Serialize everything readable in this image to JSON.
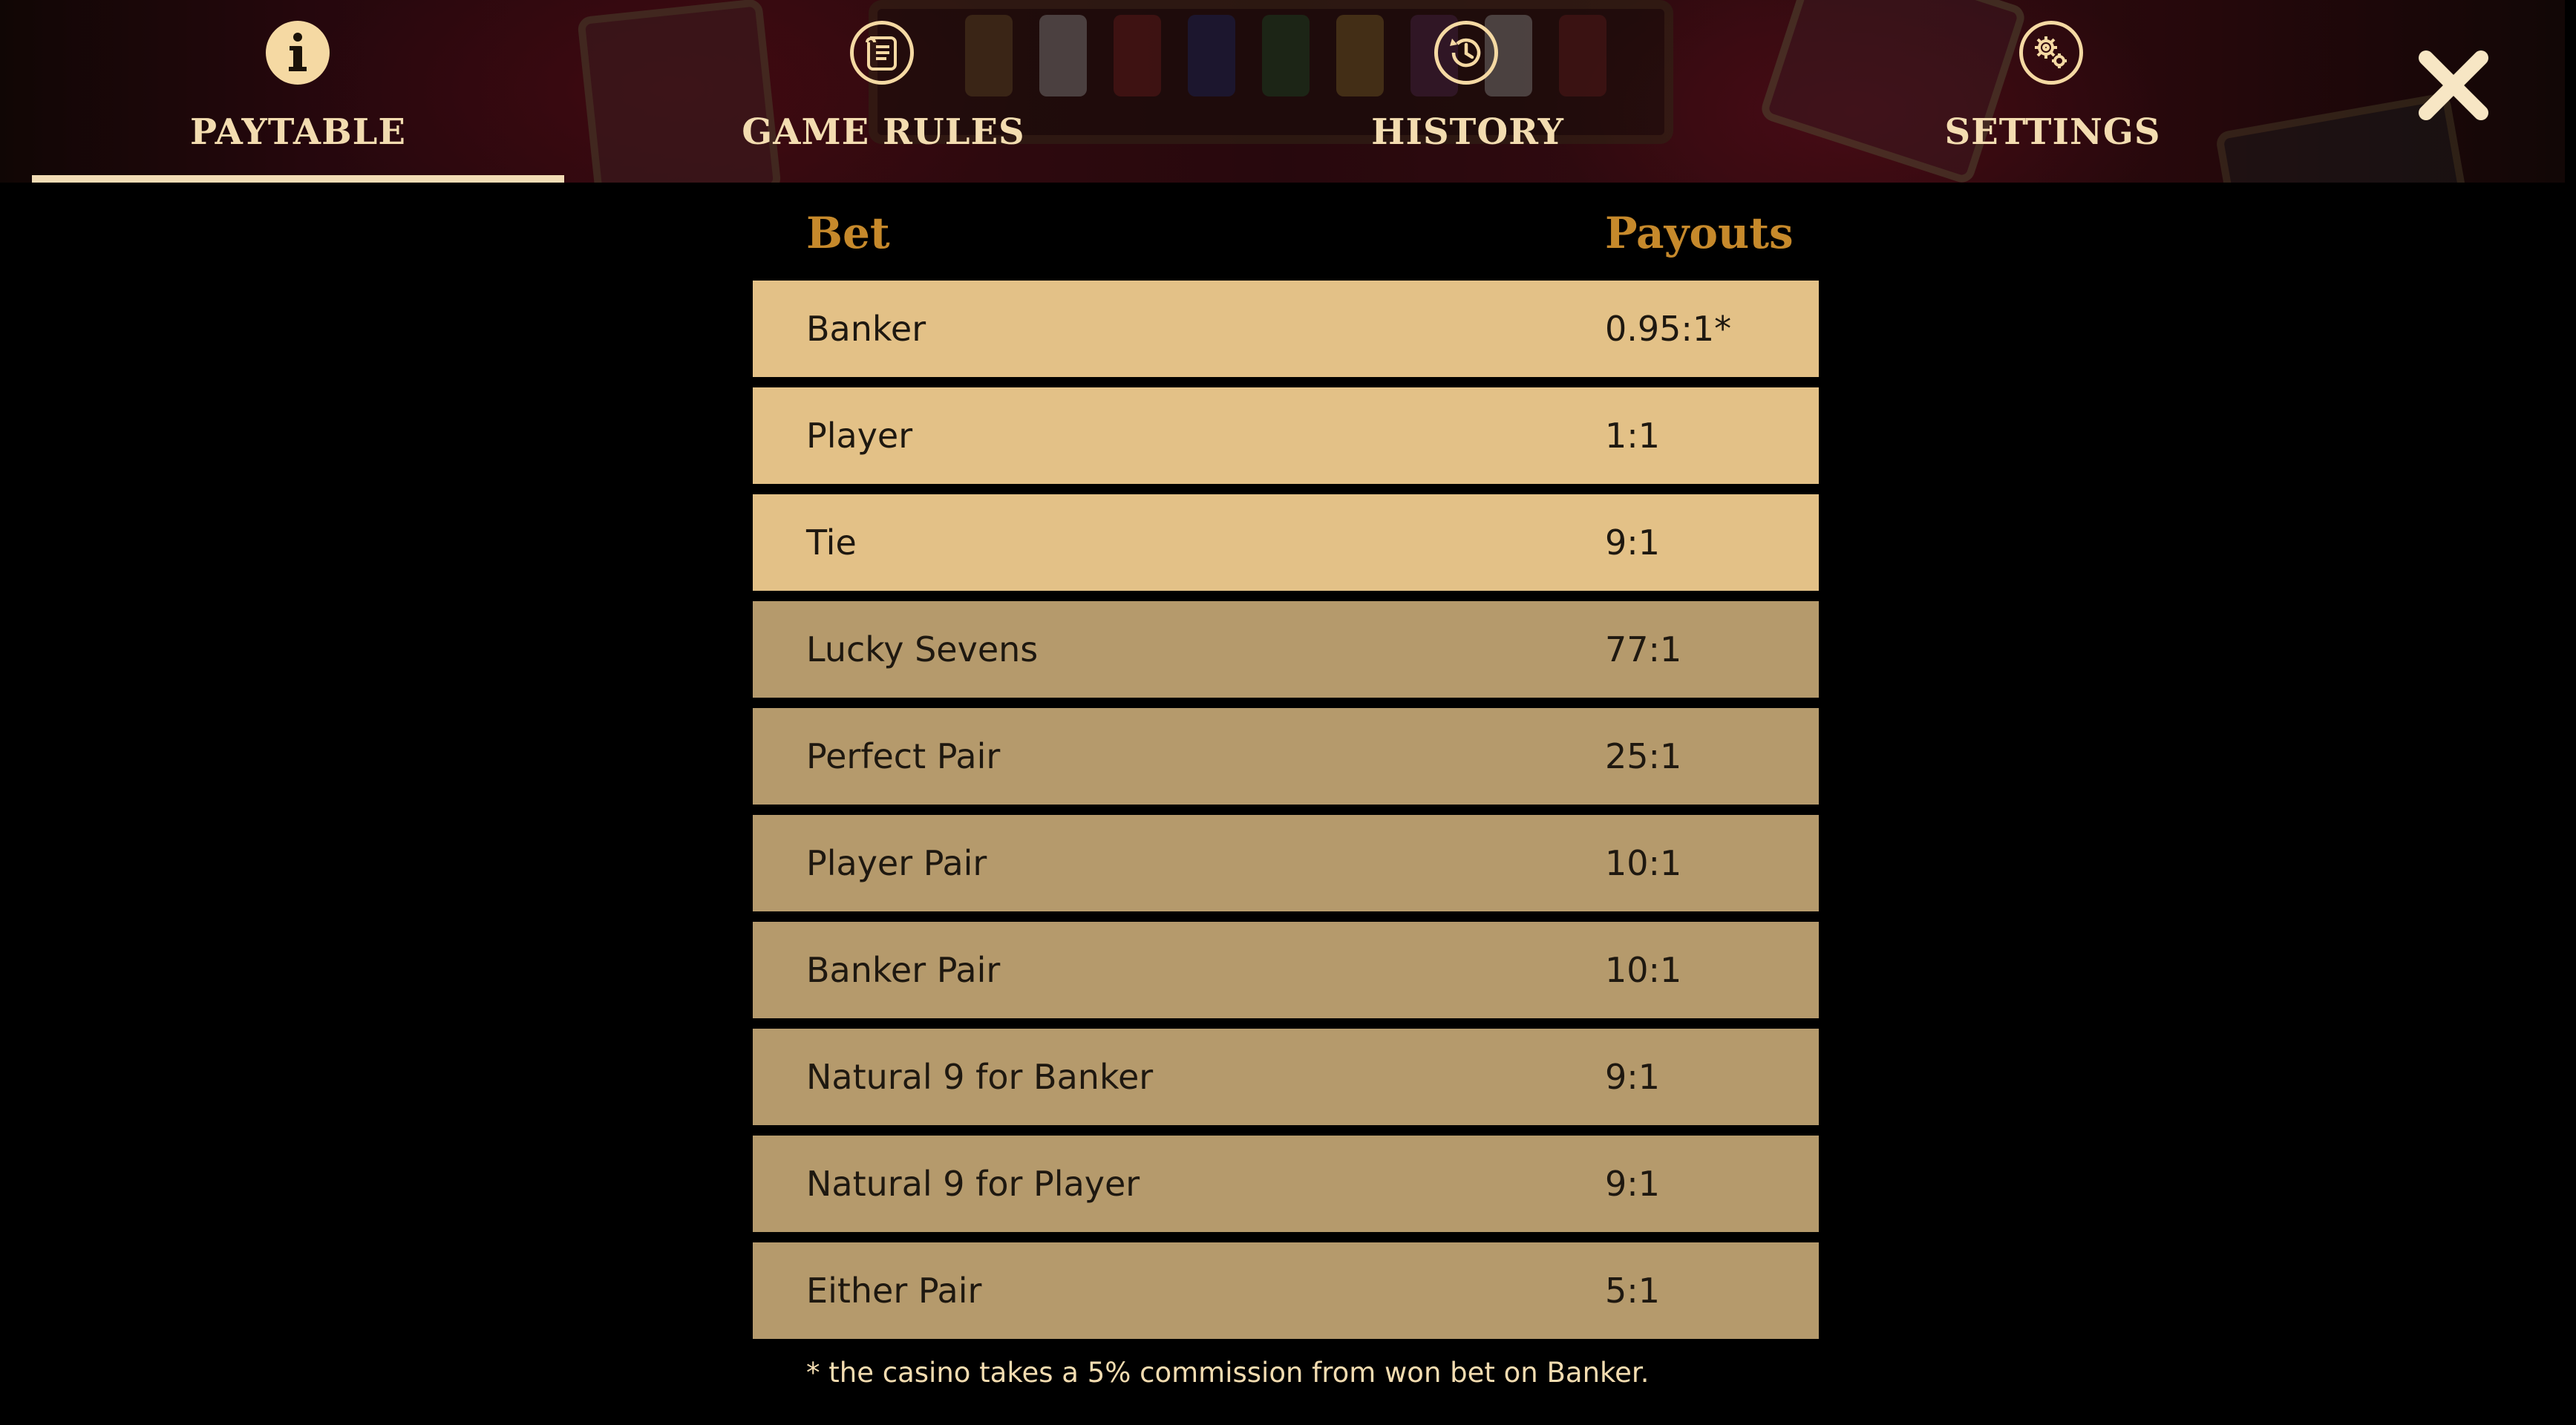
{
  "tabs": [
    {
      "label": "PAYTABLE",
      "icon": "info-icon",
      "active": true
    },
    {
      "label": "GAME RULES",
      "icon": "scroll-icon",
      "active": false
    },
    {
      "label": "HISTORY",
      "icon": "history-icon",
      "active": false
    },
    {
      "label": "SETTINGS",
      "icon": "gears-icon",
      "active": false
    }
  ],
  "close": {
    "icon": "close-icon"
  },
  "table": {
    "headers": {
      "bet": "Bet",
      "payouts": "Payouts"
    },
    "rows": [
      {
        "bet": "Banker",
        "payout": "0.95:1*"
      },
      {
        "bet": "Player",
        "payout": "1:1"
      },
      {
        "bet": "Tie",
        "payout": "9:1"
      },
      {
        "bet": "Lucky Sevens",
        "payout": "77:1"
      },
      {
        "bet": "Perfect Pair",
        "payout": "25:1"
      },
      {
        "bet": "Player Pair",
        "payout": "10:1"
      },
      {
        "bet": "Banker Pair",
        "payout": "10:1"
      },
      {
        "bet": "Natural 9 for Banker",
        "payout": "9:1"
      },
      {
        "bet": "Natural 9 for Player",
        "payout": "9:1"
      },
      {
        "bet": "Either Pair",
        "payout": "5:1"
      }
    ]
  },
  "footnote": "* the casino takes a 5% commission from won bet on Banker.",
  "colors": {
    "accent": "#f5d9a3",
    "header_text": "#c6892b",
    "row_main": "#e3c187",
    "row_side": "#b59a6c",
    "background": "#000000"
  }
}
